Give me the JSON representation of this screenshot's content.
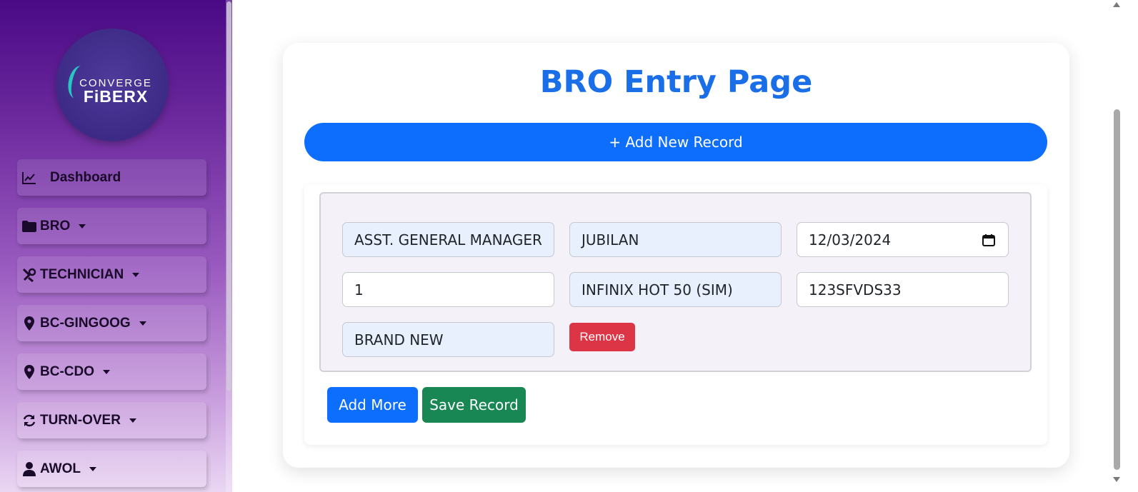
{
  "sidebar": {
    "logo": {
      "line1": "CONVERGE",
      "line2": "FiBERX"
    },
    "items": [
      {
        "label": "Dashboard",
        "icon": "chart-line-icon",
        "dropdown": false
      },
      {
        "label": "BRO",
        "icon": "folder-icon",
        "dropdown": true
      },
      {
        "label": "TECHNICIAN",
        "icon": "tools-icon",
        "dropdown": true
      },
      {
        "label": "BC-GINGOOG",
        "icon": "map-pin-icon",
        "dropdown": true
      },
      {
        "label": "BC-CDO",
        "icon": "map-pin-icon",
        "dropdown": true
      },
      {
        "label": "TURN-OVER",
        "icon": "sync-icon",
        "dropdown": true
      },
      {
        "label": "AWOL",
        "icon": "user-icon",
        "dropdown": true
      }
    ]
  },
  "main": {
    "title": "BRO Entry Page",
    "add_new_label": "+ Add New Record",
    "record": {
      "position": "ASST. GENERAL MANAGER",
      "name": "JUBILAN",
      "date": "12/03/2024",
      "quantity": "1",
      "item": "INFINIX HOT 50 (SIM)",
      "serial": "123SFVDS33",
      "condition": "BRAND NEW",
      "remove_label": "Remove"
    },
    "add_more_label": "Add More",
    "save_label": "Save Record"
  },
  "colors": {
    "primary": "#0d6efd",
    "title": "#1a6fe8",
    "danger": "#dc3545",
    "success": "#198754",
    "autofill": "#e8f0fe"
  }
}
